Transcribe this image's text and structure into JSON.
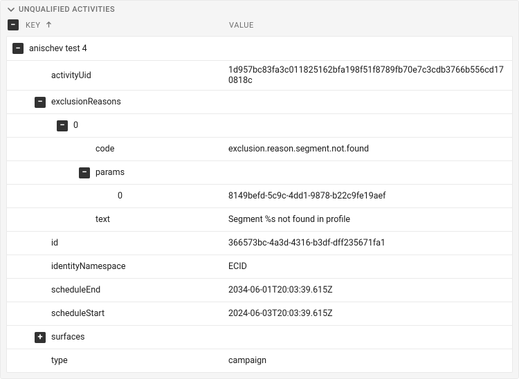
{
  "section": {
    "title": "UNQUALIFIED ACTIVITIES"
  },
  "columns": {
    "key": "KEY",
    "value": "VALUE"
  },
  "rows": [
    {
      "depth": 0,
      "toggle": "minus",
      "key": "anischev test 4",
      "value": ""
    },
    {
      "depth": 1,
      "toggle": null,
      "key": "activityUid",
      "value": "1d957bc83fa3c011825162bfa198f51f8789fb70e7c3cdb3766b556cd170818c"
    },
    {
      "depth": 1,
      "toggle": "minus",
      "key": "exclusionReasons",
      "value": ""
    },
    {
      "depth": 2,
      "toggle": "minus",
      "key": "0",
      "value": ""
    },
    {
      "depth": 3,
      "toggle": null,
      "key": "code",
      "value": "exclusion.reason.segment.not.found"
    },
    {
      "depth": 3,
      "toggle": "minus",
      "key": "params",
      "value": ""
    },
    {
      "depth": 4,
      "toggle": null,
      "key": "0",
      "value": "8149befd-5c9c-4dd1-9878-b22c9fe19aef"
    },
    {
      "depth": 3,
      "toggle": null,
      "key": "text",
      "value": "Segment %s not found in profile"
    },
    {
      "depth": 1,
      "toggle": null,
      "key": "id",
      "value": "366573bc-4a3d-4316-b3df-dff235671fa1"
    },
    {
      "depth": 1,
      "toggle": null,
      "key": "identityNamespace",
      "value": "ECID"
    },
    {
      "depth": 1,
      "toggle": null,
      "key": "scheduleEnd",
      "value": "2034-06-01T20:03:39.615Z"
    },
    {
      "depth": 1,
      "toggle": null,
      "key": "scheduleStart",
      "value": "2024-06-03T20:03:39.615Z"
    },
    {
      "depth": 1,
      "toggle": "plus",
      "key": "surfaces",
      "value": ""
    },
    {
      "depth": 1,
      "toggle": null,
      "key": "type",
      "value": "campaign"
    }
  ]
}
